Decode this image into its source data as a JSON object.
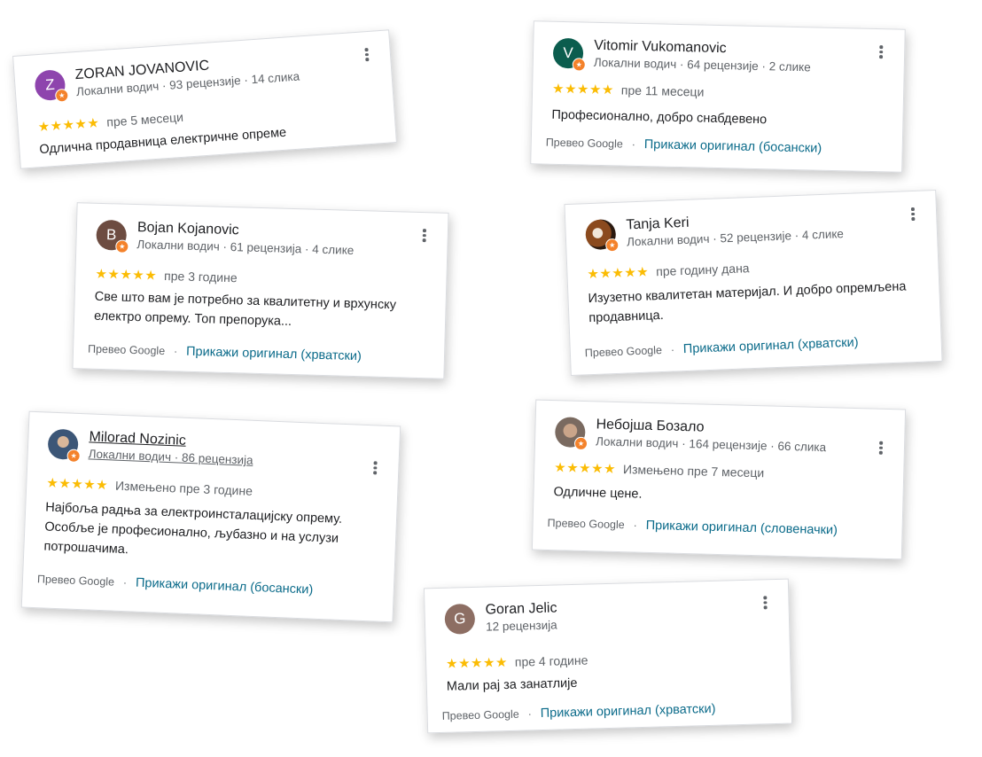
{
  "reviews": [
    {
      "name": "ZORAN JOVANOVIC",
      "initial": "Z",
      "avatar_color": "#8e44ad",
      "meta": "Локални водич · 93 рецензије · 14 слика",
      "stars": "★★★★★",
      "rating": 5,
      "when": "пре 5 месеци",
      "text": "Одлична продавница електричне опреме",
      "translated_by": "",
      "show_original": ""
    },
    {
      "name": "Vitomir Vukomanovic",
      "initial": "V",
      "avatar_color": "#0b5d4e",
      "meta": "Локални водич · 64 рецензије · 2 слике",
      "stars": "★★★★★",
      "rating": 5,
      "when": "пре 11 месеци",
      "text": "Професионално, добро снабдевено",
      "translated_by": "Превео Google",
      "show_original": "Прикажи оригинал (босански)"
    },
    {
      "name": "Bojan Kojanovic",
      "initial": "B",
      "avatar_color": "#6d4c41",
      "meta": "Локални водич · 61 рецензија · 4 слике",
      "stars": "★★★★★",
      "rating": 5,
      "when": "пре 3 године",
      "text": "Све што вам је потребно за квалитетну и врхунску електро опрему. Топ препорука...",
      "translated_by": "Превео Google",
      "show_original": "Прикажи оригинал (хрватски)"
    },
    {
      "name": "Tanja Keri",
      "initial": "",
      "avatar_color": "#7a4a22",
      "meta": "Локални водич · 52 рецензије · 4 слике",
      "stars": "★★★★★",
      "rating": 5,
      "when": "пре годину дана",
      "text": "Изузетно квалитетан материјал. И добро опремљена продавница.",
      "translated_by": "Превео Google",
      "show_original": "Прикажи оригинал (хрватски)"
    },
    {
      "name": "Milorad Nozinic",
      "initial": "",
      "avatar_color": "#4e5f74",
      "meta": "Локални водич · 86 рецензија",
      "stars": "★★★★★",
      "rating": 5,
      "when": "Измењено пре 3 године",
      "text": "Најбоља радња за електроинсталацијску опрему. Особље је професионално, љубазно и на услузи потрошачима.",
      "translated_by": "Превео Google",
      "show_original": "Прикажи оригинал (босански)"
    },
    {
      "name": "Небојша Бозало",
      "initial": "",
      "avatar_color": "#8a7566",
      "meta": "Локални водич · 164 рецензије · 66 слика",
      "stars": "★★★★★",
      "rating": 5,
      "when": "Измењено пре 7 месеци",
      "text": "Одличне цене.",
      "translated_by": "Превео Google",
      "show_original": "Прикажи оригинал (словеначки)"
    },
    {
      "name": "Goran Jelic",
      "initial": "G",
      "avatar_color": "#8d6e63",
      "meta": "12 рецензија",
      "stars": "★★★★★",
      "rating": 5,
      "when": "пре 4 године",
      "text": "Мали рај за занатлије",
      "translated_by": "Превео Google",
      "show_original": "Прикажи оригинал (хрватски)"
    }
  ]
}
